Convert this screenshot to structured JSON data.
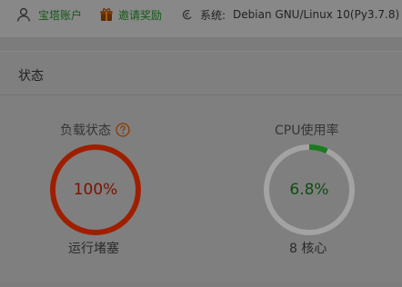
{
  "topbar": {
    "account_label": "宝塔账户",
    "account_icon": "user-icon",
    "invite_label": "邀请奖励",
    "invite_icon": "gift-icon",
    "system_icon": "debian-icon",
    "system_label": "系统:",
    "system_value": "Debian GNU/Linux 10(Py3.7.8)"
  },
  "status_panel": {
    "title": "状态",
    "load": {
      "label": "负载状态",
      "help_icon": "question-icon",
      "value": "100%",
      "percent": 100,
      "status": "运行堵塞",
      "ring_color": "#9e1f00"
    },
    "cpu": {
      "label": "CPU使用率",
      "value": "6.8%",
      "percent": 6.8,
      "cores": "8 核心",
      "ring_color": "#1b7a1f",
      "track_color": "#a3a3a3"
    }
  }
}
